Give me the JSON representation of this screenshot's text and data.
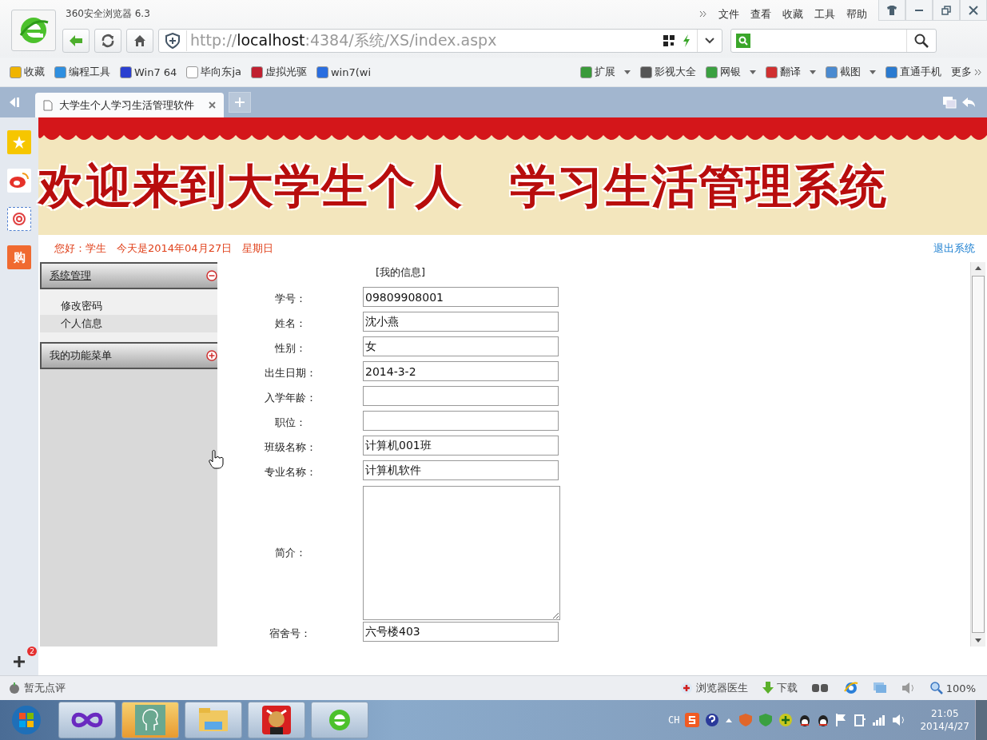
{
  "browser": {
    "title": "360安全浏览器 6.3",
    "menu": [
      "文件",
      "查看",
      "收藏",
      "工具",
      "帮助"
    ],
    "address": "http://**localhost**:4384/系统/XS/index.aspx",
    "bookmarks": [
      {
        "label": "收藏",
        "kind": "fav"
      },
      {
        "label": "编程工具",
        "kind": "cloud"
      },
      {
        "label": "Win7 64",
        "kind": "paw"
      },
      {
        "label": "毕向东ja",
        "kind": "page"
      },
      {
        "label": "虚拟光驱",
        "kind": "disc"
      },
      {
        "label": "win7(wi",
        "kind": "globe"
      }
    ],
    "extensions": [
      {
        "label": "扩展",
        "kind": "grid",
        "dropdown": true
      },
      {
        "label": "影视大全",
        "kind": "film",
        "dropdown": false
      },
      {
        "label": "网银",
        "kind": "shield",
        "dropdown": true
      },
      {
        "label": "翻译",
        "kind": "book",
        "dropdown": true
      },
      {
        "label": "截图",
        "kind": "shot",
        "dropdown": true
      },
      {
        "label": "直通手机",
        "kind": "phone",
        "dropdown": false
      }
    ],
    "more": "更多",
    "tabs": [
      {
        "label": "大学生个人学习生活管理软件",
        "selected": true
      }
    ]
  },
  "sidebar": {
    "shop_label": "购",
    "badge": "2"
  },
  "page": {
    "banner": "欢迎来到大学生个人　学习生活管理系统",
    "greeting": "您好：学生　今天是2014年04月27日　星期日",
    "logout": "退出系统",
    "menu": [
      {
        "title": "系统管理",
        "expanded": true,
        "items": [
          {
            "label": "修改密码",
            "selected": false
          },
          {
            "label": "个人信息",
            "selected": true
          }
        ]
      },
      {
        "title": "我的功能菜单",
        "expanded": false
      }
    ],
    "form_title": "[我的信息]",
    "fields": [
      {
        "label": "学号：",
        "value": "09809908001",
        "kind": "input"
      },
      {
        "label": "姓名：",
        "value": "沈小燕",
        "kind": "input"
      },
      {
        "label": "性别：",
        "value": "女",
        "kind": "input"
      },
      {
        "label": "出生日期：",
        "value": "2014-3-2",
        "kind": "input"
      },
      {
        "label": "入学年龄：",
        "kind": "input"
      },
      {
        "label": "职位：",
        "kind": "input"
      },
      {
        "label": "班级名称：",
        "value": "计算机001班",
        "kind": "input"
      },
      {
        "label": "专业名称：",
        "value": "计算机软件",
        "kind": "input"
      },
      {
        "label": "简介：",
        "kind": "textarea"
      },
      {
        "label": "宿舍号：",
        "value": "六号楼403",
        "kind": "input"
      }
    ]
  },
  "status_bar": {
    "review": "暂无点评",
    "doctor": "浏览器医生",
    "download": "下载",
    "zoom": "100%"
  },
  "taskbar": {
    "lang": "CH",
    "time": "21:05",
    "date": "2014/4/27"
  }
}
